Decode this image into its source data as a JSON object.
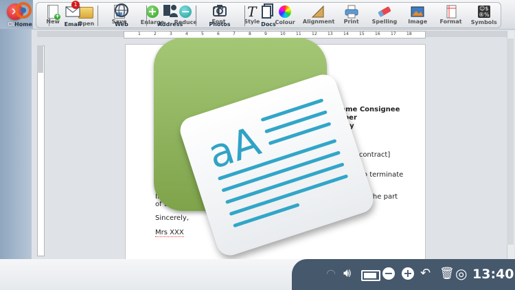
{
  "close": {
    "label": "Close"
  },
  "toolbar": {
    "tools": [
      {
        "label": "New",
        "icon": "new-doc-icon"
      },
      {
        "label": "Open",
        "icon": "open-folder-icon"
      },
      {
        "label": "Save",
        "icon": "save-icon"
      },
      {
        "label": "Enlarge",
        "icon": "plus-icon"
      },
      {
        "label": "Reduce",
        "icon": "minus-icon"
      },
      {
        "label": "Font",
        "icon": "font-t-icon"
      },
      {
        "label": "Style",
        "icon": "style-t-icon"
      },
      {
        "label": "Colour",
        "icon": "colour-wheel-icon"
      },
      {
        "label": "Alignment",
        "icon": "ruler-triangle-icon"
      },
      {
        "label": "Print",
        "icon": "printer-icon"
      },
      {
        "label": "Spelling",
        "icon": "eraser-icon"
      },
      {
        "label": "Image",
        "icon": "image-icon"
      },
      {
        "label": "Format",
        "icon": "page-format-icon"
      },
      {
        "label": "Symbols",
        "icon": "symbols-icon"
      }
    ]
  },
  "ruler": {
    "numbers": [
      "1",
      "2",
      "3",
      "4",
      "5",
      "6",
      "7",
      "8",
      "9",
      "10",
      "11",
      "12",
      "13",
      "14",
      "15",
      "16",
      "17",
      "18"
    ]
  },
  "document": {
    "lines": [
      {
        "text": "t name Consignee",
        "bold": true
      },
      {
        "text": "ber",
        "bold": true
      },
      {
        "text": "city",
        "bold": true
      },
      {
        "text": "of contract]",
        "bold": false
      },
      {
        "text": "to terminate",
        "bold": false
      },
      {
        "text": "In a",
        "bold": false
      },
      {
        "text": "the part",
        "bold": false
      },
      {
        "text": "of the",
        "bold": false
      },
      {
        "text": "Sincerely,",
        "bold": false
      },
      {
        "text": "Mrs XXX",
        "bold": false
      }
    ]
  },
  "app_icon": {
    "glyph_text": "aA",
    "name": "text-editor-app-icon"
  },
  "dock": {
    "items": [
      {
        "label": "Home",
        "icon": "home-logo-icon"
      },
      {
        "label": "Email",
        "icon": "email-icon",
        "badge": "1"
      },
      {
        "label": "Web",
        "icon": "globe-icon"
      },
      {
        "label": "Address",
        "icon": "address-book-icon"
      },
      {
        "label": "Photos",
        "icon": "camera-icon"
      },
      {
        "label": "Docs",
        "icon": "docs-icon"
      }
    ],
    "status": {
      "clock": "13:40"
    }
  },
  "colors": {
    "accent": "#45586c",
    "green": "#8fb35e",
    "teal": "#3aa7c4"
  }
}
